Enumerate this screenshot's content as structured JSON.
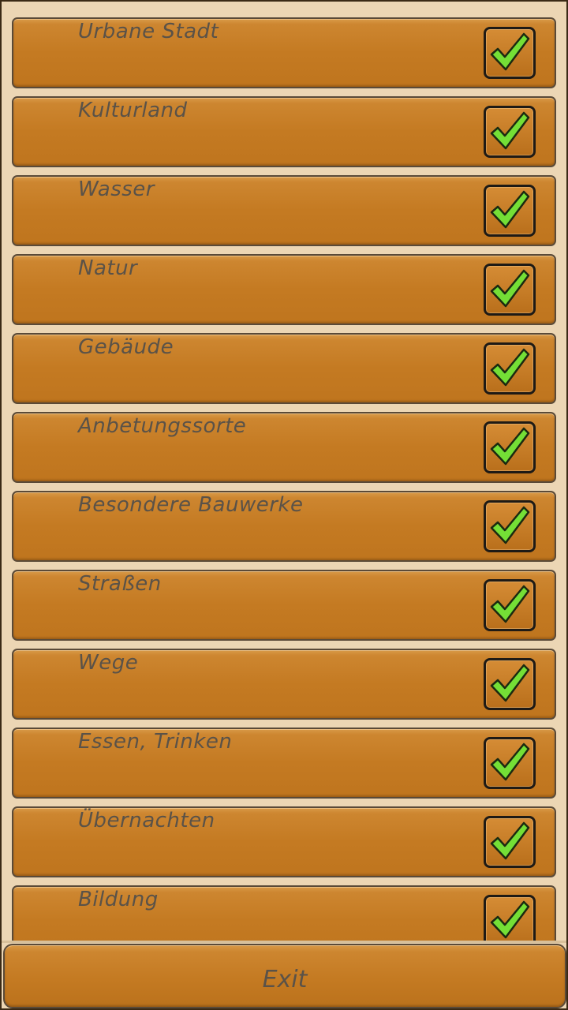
{
  "categories": [
    {
      "label": "Urbane Stadt",
      "checked": true
    },
    {
      "label": "Kulturland",
      "checked": true
    },
    {
      "label": "Wasser",
      "checked": true
    },
    {
      "label": "Natur",
      "checked": true
    },
    {
      "label": "Gebäude",
      "checked": true
    },
    {
      "label": "Anbetungssorte",
      "checked": true
    },
    {
      "label": "Besondere Bauwerke",
      "checked": true
    },
    {
      "label": "Straßen",
      "checked": true
    },
    {
      "label": "Wege",
      "checked": true
    },
    {
      "label": "Essen, Trinken",
      "checked": true
    },
    {
      "label": "Übernachten",
      "checked": true
    },
    {
      "label": "Bildung",
      "checked": true
    }
  ],
  "exit_label": "Exit",
  "colors": {
    "row_orange": "#c47a22",
    "label_text": "#5a5248",
    "check_green": "#7ae23a",
    "background": "#ecd6b4"
  },
  "icons": {
    "check": "checkmark-icon"
  }
}
